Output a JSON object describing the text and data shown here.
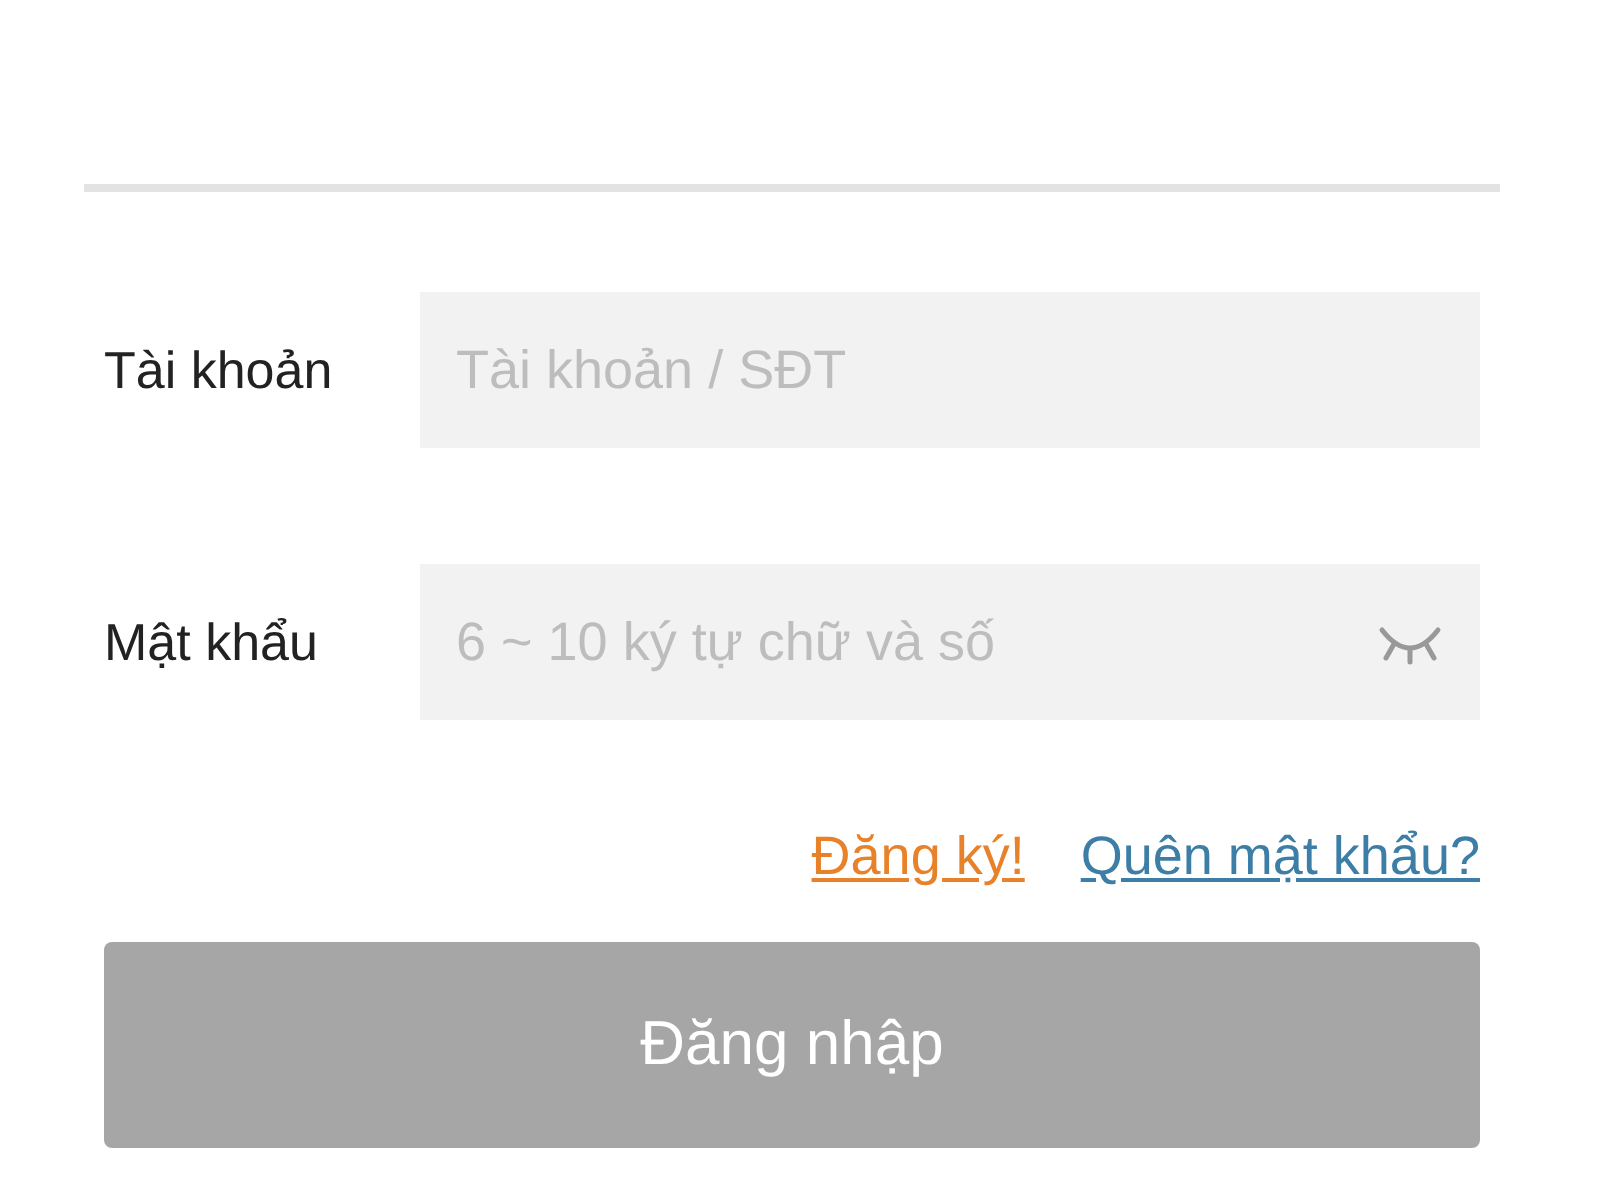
{
  "fields": [
    {
      "label": "Tài khoản",
      "placeholder": "Tài khoản / SĐT",
      "kind": "text"
    },
    {
      "label": "Mật khẩu",
      "placeholder": "6 ~ 10 ký tự chữ và số",
      "kind": "password"
    }
  ],
  "links": [
    {
      "text": "Đăng ký!",
      "color": "#e8822a"
    },
    {
      "text": "Quên mật khẩu?",
      "color": "#3d7ea6"
    }
  ],
  "submit": {
    "text": "Đăng nhập",
    "disabled": true
  }
}
